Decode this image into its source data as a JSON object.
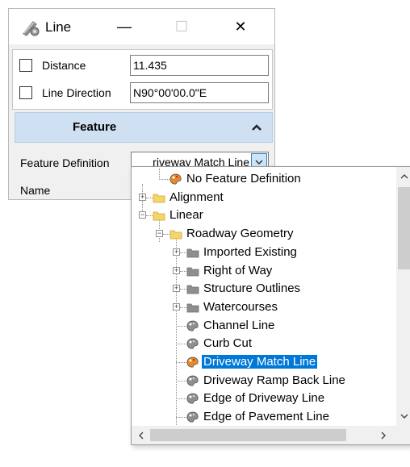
{
  "window": {
    "title": "Line",
    "icon": "line-tool-icon",
    "controls": {
      "minimize": "—",
      "maximize": "☐",
      "close": "✕"
    }
  },
  "fields": {
    "distance": {
      "label": "Distance",
      "value": "11.435",
      "checked": false
    },
    "line_direction": {
      "label": "Line Direction",
      "value": "N90°00'00.0\"E",
      "checked": false
    }
  },
  "feature": {
    "header": "Feature",
    "definition_label": "Feature Definition",
    "definition_value": "riveway Match Line",
    "name_label": "Name"
  },
  "tree": {
    "items": [
      {
        "label": "No Feature Definition",
        "icon": "feature-icon-orange"
      },
      {
        "label": "Alignment",
        "icon": "folder-icon",
        "expander": "+"
      },
      {
        "label": "Linear",
        "icon": "folder-icon",
        "expander": "-"
      },
      {
        "label": "Roadway Geometry",
        "icon": "folder-icon",
        "expander": "-"
      },
      {
        "label": "Imported Existing",
        "icon": "folder-gray-icon",
        "expander": "+"
      },
      {
        "label": "Right of Way",
        "icon": "folder-gray-icon",
        "expander": "+"
      },
      {
        "label": "Structure Outlines",
        "icon": "folder-gray-icon",
        "expander": "+"
      },
      {
        "label": "Watercourses",
        "icon": "folder-gray-icon",
        "expander": "+"
      },
      {
        "label": "Channel Line",
        "icon": "feature-icon-gray"
      },
      {
        "label": "Curb Cut",
        "icon": "feature-icon-gray"
      },
      {
        "label": "Driveway Match Line",
        "icon": "feature-icon-orange",
        "selected": true
      },
      {
        "label": "Driveway Ramp Back Line",
        "icon": "feature-icon-gray"
      },
      {
        "label": "Edge of Driveway Line",
        "icon": "feature-icon-gray"
      },
      {
        "label": "Edge of Pavement Line",
        "icon": "feature-icon-gray"
      }
    ]
  },
  "colors": {
    "selection": "#0078d7",
    "section_header": "#cfe0f2",
    "folder": "#f5d56a"
  }
}
